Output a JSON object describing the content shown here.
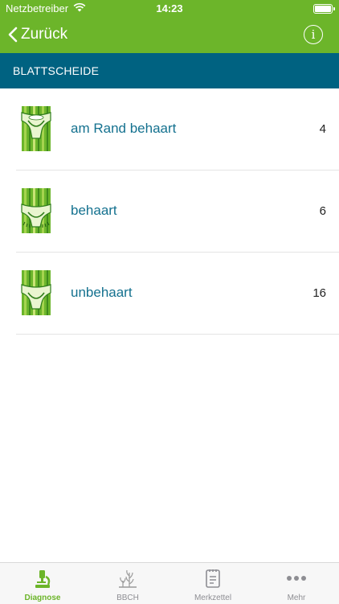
{
  "status_bar": {
    "carrier": "Netzbetreiber",
    "time": "14:23"
  },
  "nav": {
    "back_label": "Zurück",
    "info_icon": "info-icon"
  },
  "section_title": "BLATTSCHEIDE",
  "items": [
    {
      "label": "am Rand behaart",
      "count": "4",
      "icon": "leaf-sheath-ciliate-margin-icon"
    },
    {
      "label": "behaart",
      "count": "6",
      "icon": "leaf-sheath-hairy-icon"
    },
    {
      "label": "unbehaart",
      "count": "16",
      "icon": "leaf-sheath-glabrous-icon"
    }
  ],
  "tabs": [
    {
      "label": "Diagnose",
      "icon": "microscope-icon",
      "active": true
    },
    {
      "label": "BBCH",
      "icon": "plant-growth-icon",
      "active": false
    },
    {
      "label": "Merkzettel",
      "icon": "notepad-icon",
      "active": false
    },
    {
      "label": "Mehr",
      "icon": "more-dots-icon",
      "active": false
    }
  ],
  "colors": {
    "brand_green": "#6cb52a",
    "section_blue": "#006281",
    "link_blue": "#14718f"
  }
}
